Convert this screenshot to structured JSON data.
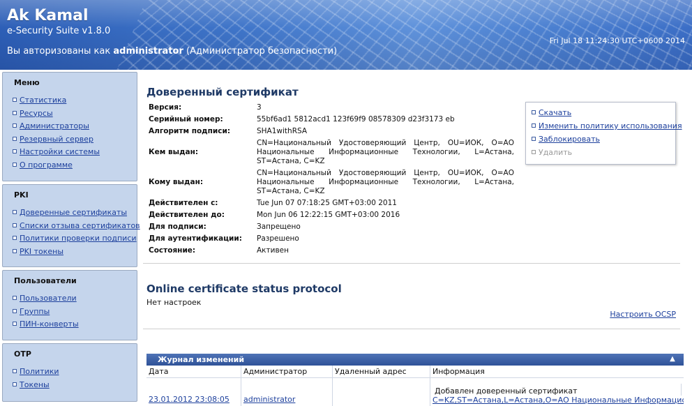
{
  "header": {
    "app_title": "Ak Kamal",
    "version": "e-Security Suite v1.8.0",
    "auth_prefix": "Вы авторизованы как",
    "user": "administrator",
    "role": "(Администратор безопасности)",
    "datetime": "Fri Jul 18 11:24:30 UTC+0600 2014"
  },
  "sidebar": {
    "menu": {
      "title": "Меню",
      "items": [
        "Статистика",
        "Ресурсы",
        "Администраторы",
        "Резервный сервер",
        "Настройки системы",
        "О программе"
      ]
    },
    "pki": {
      "title": "PKI",
      "items": [
        "Доверенные сертификаты",
        "Списки отзыва сертификатов",
        "Политики проверки подписи",
        "PKI токены"
      ]
    },
    "users": {
      "title": "Пользователи",
      "items": [
        "Пользователи",
        "Группы",
        "ПИН-конверты"
      ]
    },
    "otp": {
      "title": "OTP",
      "items": [
        "Политики",
        "Токены"
      ]
    }
  },
  "cert": {
    "title": "Доверенный сертификат",
    "rows": [
      {
        "label": "Версия:",
        "value": "3"
      },
      {
        "label": "Серийный номер:",
        "value": "55bf6ad1 5812acd1 123f69f9 08578309 d23f3173 eb"
      },
      {
        "label": "Алгоритм подписи:",
        "value": "SHA1withRSA"
      },
      {
        "label": "Кем выдан:",
        "value": "CN=Национальный Удостоверяющий Центр, OU=ИОК, O=АО Национальные Информационные Технологии, L=Астана, ST=Астана, C=KZ"
      },
      {
        "label": "Кому выдан:",
        "value": "CN=Национальный Удостоверяющий Центр, OU=ИОК, O=АО Национальные Информационные Технологии, L=Астана, ST=Астана, C=KZ"
      },
      {
        "label": "Действителен с:",
        "value": "Tue Jun 07 07:18:25 GMT+03:00 2011"
      },
      {
        "label": "Действителен до:",
        "value": "Mon Jun 06 12:22:15 GMT+03:00 2016"
      },
      {
        "label": "Для подписи:",
        "value": "Запрещено"
      },
      {
        "label": "Для аутентификации:",
        "value": "Разрешено"
      },
      {
        "label": "Состояние:",
        "value": "Активен"
      }
    ]
  },
  "actions": {
    "download": "Скачать",
    "change_policy": "Изменить политику использования",
    "block": "Заблокировать",
    "delete": "Удалить"
  },
  "ocsp": {
    "title": "Online certificate status protocol",
    "none": "Нет настроек",
    "configure": "Настроить OCSP"
  },
  "log": {
    "title": "Журнал изменений",
    "columns": [
      "Дата",
      "Администратор",
      "Удаленный адрес",
      "Информация"
    ],
    "rows": [
      {
        "date": "23.01.2012 23:08:05",
        "admin": "administrator",
        "address": "",
        "info_text": "Добавлен доверенный сертификат",
        "info_link": "C=KZ,ST=Астана,L=Астана,O=АО Национальные Информационные"
      }
    ]
  }
}
